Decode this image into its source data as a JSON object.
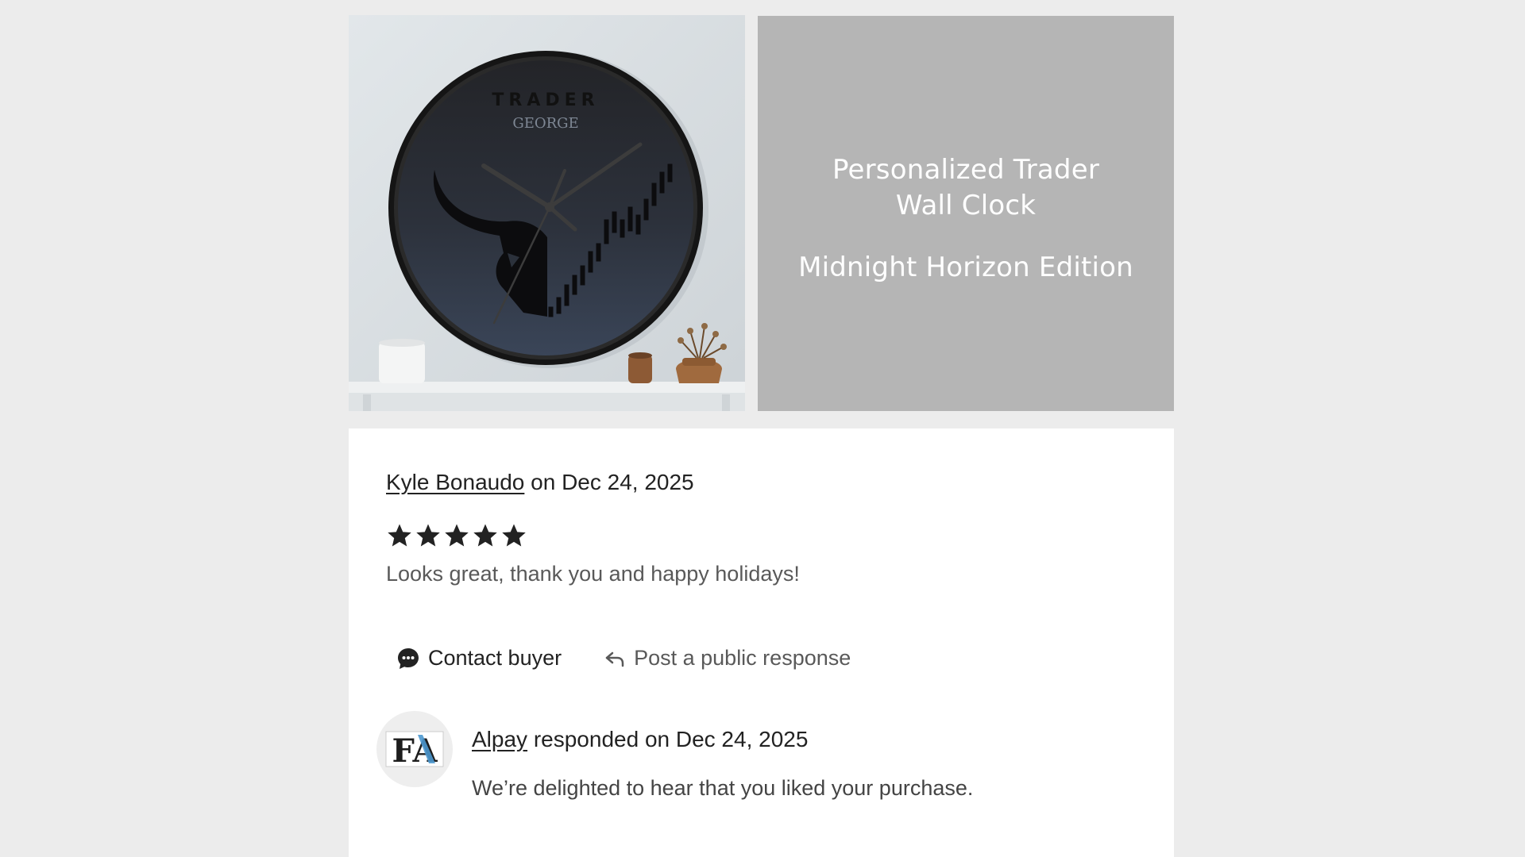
{
  "product": {
    "image_alt": "Trader wall clock with bull and candlestick design",
    "clock_brand_line": "TRADER",
    "clock_name_line": "GEORGE",
    "title_line_1": "Personalized Trader",
    "title_line_2": "Wall Clock",
    "edition": "Midnight Horizon Edition"
  },
  "review": {
    "reviewer_name": "Kyle Bonaudo",
    "date_text": "on Dec 24, 2025",
    "rating": 5,
    "rating_max": 5,
    "text": "Looks great, thank you and happy holidays!"
  },
  "actions": {
    "contact_label": "Contact buyer",
    "public_response_label": "Post a public response"
  },
  "response": {
    "seller_name": "Alpay",
    "date_text": "responded on Dec 24, 2025",
    "avatar_initials": "FA",
    "text": "We’re delighted to hear that you liked your purchase."
  },
  "colors": {
    "page_background": "#ececec",
    "title_panel": "#b5b5b5",
    "star": "#222222",
    "clock_face_top": "#232428",
    "clock_face_bottom": "#3a4558"
  }
}
